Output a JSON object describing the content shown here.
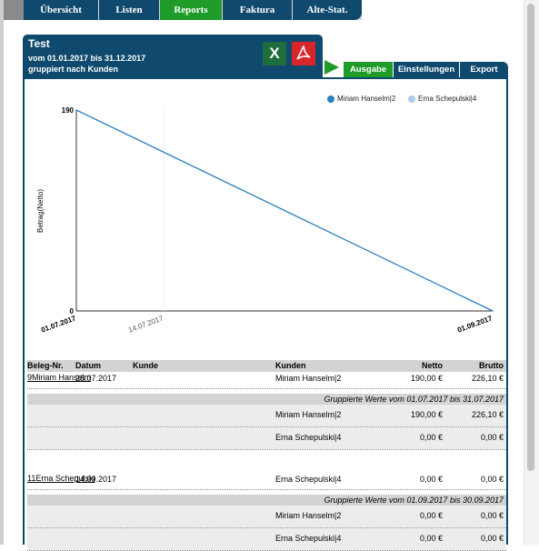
{
  "topnav": {
    "tabs": [
      {
        "label": "Übersicht",
        "active": false
      },
      {
        "label": "Listen",
        "active": false
      },
      {
        "label": "Reports",
        "active": true
      },
      {
        "label": "Faktura",
        "active": false
      },
      {
        "label": "Alte-Stat.",
        "active": false
      }
    ]
  },
  "report": {
    "title": "Test",
    "period": "vom 01.01.2017 bis 31.12.2017",
    "grouping": "gruppiert nach Kunden",
    "excel_icon": "excel-icon",
    "excel_label": "X",
    "pdf_icon": "pdf-icon"
  },
  "subtabs": [
    {
      "label": "Ausgabe",
      "active": true
    },
    {
      "label": "Einstellungen",
      "active": false
    },
    {
      "label": "Export",
      "active": false
    }
  ],
  "colors": {
    "nav": "#0f4a6e",
    "active": "#1f9b2a",
    "series1": "#2a7fc1",
    "series2": "#aecbe6"
  },
  "chart_data": {
    "type": "line",
    "ylabel": "Betrag(Netto)",
    "xlabel": "",
    "ylim": [
      0,
      190
    ],
    "y_ticks": [
      "190",
      "0"
    ],
    "x_ticks": [
      "01.07.2017",
      "14.07.2017",
      "01.09.2017"
    ],
    "legend_position": "top-right",
    "series": [
      {
        "name": "Miriam Hanselm|2",
        "x": [
          "01.07.2017",
          "01.09.2017"
        ],
        "values": [
          190,
          0
        ]
      },
      {
        "name": "Erna Schepulski|4",
        "x": [],
        "values": []
      }
    ]
  },
  "table": {
    "headers": [
      "Beleg-Nr.",
      "Datum",
      "Kunde",
      "Kunden",
      "Netto",
      "Brutto"
    ],
    "sections": [
      {
        "row": [
          "9",
          "28.07.2017",
          "Miriam Hanselm",
          "Miriam Hanselm|2",
          "190,00 €",
          "226,10 €"
        ],
        "group_label": "Gruppierte Werte vom 01.07.2017 bis 31.07.2017",
        "subrows": [
          [
            "Miriam Hanselm|2",
            "190,00 €",
            "226,10 €"
          ],
          [
            "Erna Schepulski|4",
            "0,00 €",
            "0,00 €"
          ]
        ]
      },
      {
        "row": [
          "11",
          "14.09.2017",
          "Erna Schepulski",
          "Erna Schepulski|4",
          "0,00 €",
          "0,00 €"
        ],
        "group_label": "Gruppierte Werte vom 01.09.2017 bis 30.09.2017",
        "subrows": [
          [
            "Miriam Hanselm|2",
            "0,00 €",
            "0,00 €"
          ],
          [
            "Erna Schepulski|4",
            "0,00 €",
            "0,00 €"
          ]
        ]
      }
    ]
  }
}
